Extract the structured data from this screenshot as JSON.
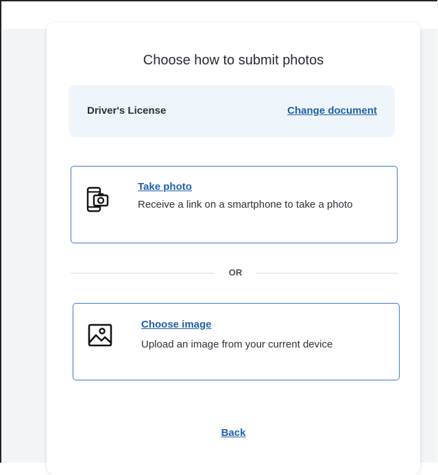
{
  "modal": {
    "title": "Choose how to submit photos",
    "document": {
      "name": "Driver's License",
      "change_label": "Change document"
    },
    "options": [
      {
        "icon": "smartphone-camera-icon",
        "title": "Take photo",
        "description": "Receive a link on a smartphone to take a photo"
      },
      {
        "icon": "image-icon",
        "title": "Choose image",
        "description": "Upload an image from your current device"
      }
    ],
    "separator_label": "OR",
    "back_label": "Back"
  },
  "colors": {
    "accent": "#1f5fa8",
    "option_border": "#3b79c9",
    "doc_box_bg": "#eef6fc",
    "text": "#2b2f37"
  }
}
